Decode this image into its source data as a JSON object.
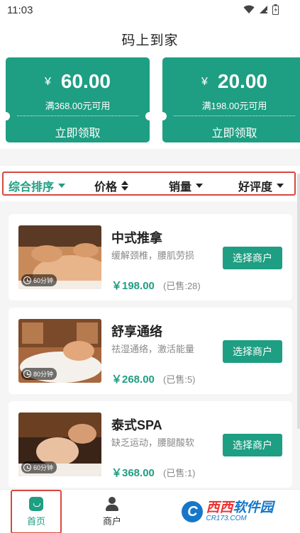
{
  "status_bar": {
    "time": "11:03"
  },
  "header": {
    "title": "码上到家"
  },
  "coupons": [
    {
      "symbol": "¥",
      "amount": "60.00",
      "condition": "满368.00元可用",
      "claim_label": "立即领取"
    },
    {
      "symbol": "¥",
      "amount": "20.00",
      "condition": "满198.00元可用",
      "claim_label": "立即领取"
    }
  ],
  "sort": {
    "items": [
      {
        "label": "综合排序",
        "active": true
      },
      {
        "label": "价格",
        "active": false
      },
      {
        "label": "销量",
        "active": false
      },
      {
        "label": "好评度",
        "active": false
      }
    ]
  },
  "services": [
    {
      "name": "中式推拿",
      "desc": "缓解颈椎，腰肌劳损",
      "price": "￥198.00",
      "sold": "(已售:28)",
      "duration": "60分钟",
      "button": "选择商户"
    },
    {
      "name": "舒享通络",
      "desc": "祛湿通络，激活能量",
      "price": "￥268.00",
      "sold": "(已售:5)",
      "duration": "80分钟",
      "button": "选择商户"
    },
    {
      "name": "泰式SPA",
      "desc": "缺乏运动，腰腿酸软",
      "price": "￥368.00",
      "sold": "(已售:1)",
      "duration": "60分钟",
      "button": "选择商户"
    }
  ],
  "tabs": {
    "home": "首页",
    "merchant": "商户"
  },
  "watermark": {
    "logo": "C",
    "main_a": "西西",
    "main_b": "软件园",
    "sub": "CR173.COM"
  },
  "colors": {
    "accent": "#1e9e82",
    "highlight": "#d9473d"
  }
}
